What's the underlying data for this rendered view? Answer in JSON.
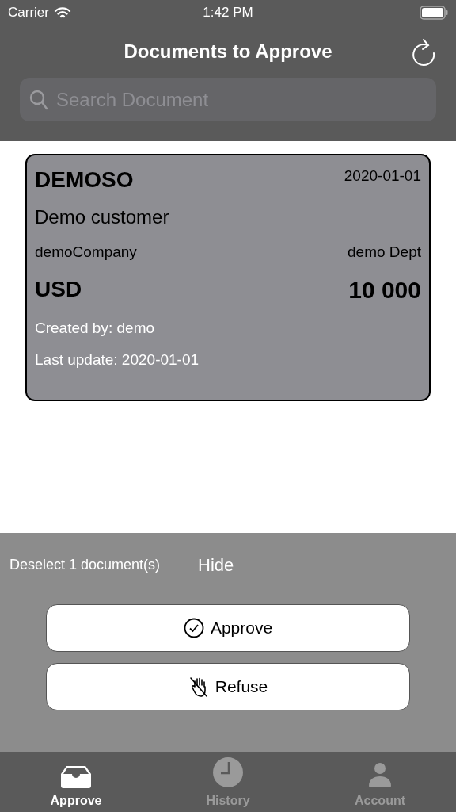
{
  "status_bar": {
    "carrier": "Carrier",
    "time": "1:42 PM"
  },
  "nav": {
    "title": "Documents to Approve"
  },
  "search": {
    "placeholder": "Search Document"
  },
  "documents": [
    {
      "code": "DEMOSO",
      "date": "2020-01-01",
      "customer": "Demo customer",
      "company": "demoCompany",
      "department": "demo Dept",
      "currency": "USD",
      "amount": "10 000",
      "created_by": "Created by: demo",
      "last_update": "Last update: 2020-01-01",
      "selected": true
    }
  ],
  "selection_bar": {
    "deselect": "Deselect 1 document(s)",
    "hide": "Hide"
  },
  "actions": [
    {
      "kind": "approve",
      "label": "Approve"
    },
    {
      "kind": "refuse",
      "label": "Refuse"
    }
  ],
  "tabs": [
    {
      "kind": "inbox",
      "label": "Approve",
      "selected": true
    },
    {
      "kind": "history",
      "label": "History",
      "selected": false
    },
    {
      "kind": "account",
      "label": "Account",
      "selected": false
    }
  ]
}
